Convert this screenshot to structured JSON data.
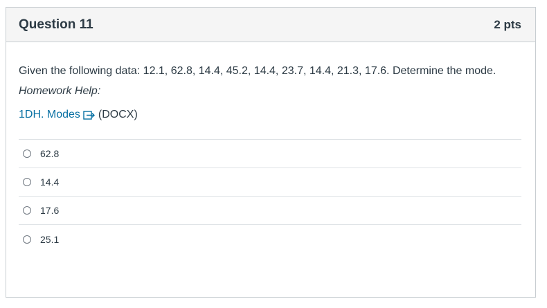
{
  "question": {
    "title": "Question 11",
    "points": "2 pts",
    "text": "Given the following data:  12.1, 62.8, 14.4, 45.2, 14.4, 23.7, 14.4, 21.3, 17.6.  Determine the mode.",
    "help_label": "Homework Help:",
    "help_link": "1DH. Modes",
    "help_link_icon": "external-link-icon",
    "help_suffix": "(DOCX)"
  },
  "answers": [
    {
      "label": "62.8",
      "selected": false
    },
    {
      "label": "14.4",
      "selected": false
    },
    {
      "label": "17.6",
      "selected": false
    },
    {
      "label": "25.1",
      "selected": false
    }
  ],
  "colors": {
    "link": "#0770a3",
    "header_bg": "#f5f5f5",
    "border": "#c7cdd1",
    "text": "#2d3b45"
  }
}
